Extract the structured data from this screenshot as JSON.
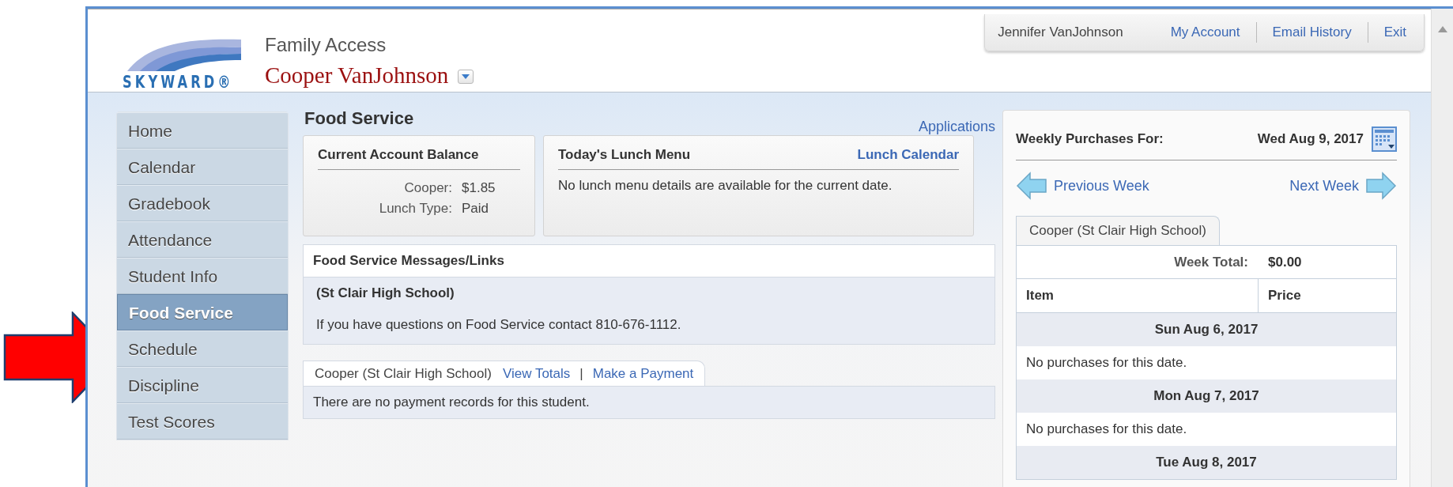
{
  "header": {
    "logo_text": "SKYWARD®",
    "app_title": "Family Access",
    "student_name": "Cooper VanJohnson"
  },
  "user_menu": {
    "user_name": "Jennifer VanJohnson",
    "links": [
      "My Account",
      "Email History",
      "Exit"
    ]
  },
  "sidebar": {
    "items": [
      {
        "label": "Home",
        "selected": false
      },
      {
        "label": "Calendar",
        "selected": false
      },
      {
        "label": "Gradebook",
        "selected": false
      },
      {
        "label": "Attendance",
        "selected": false
      },
      {
        "label": "Student Info",
        "selected": false
      },
      {
        "label": "Food Service",
        "selected": true
      },
      {
        "label": "Schedule",
        "selected": false
      },
      {
        "label": "Discipline",
        "selected": false
      },
      {
        "label": "Test Scores",
        "selected": false
      }
    ]
  },
  "food_service": {
    "title": "Food Service",
    "applications_link": "Applications",
    "balance_card": {
      "title": "Current Account Balance",
      "rows": [
        {
          "label": "Cooper:",
          "value": "$1.85"
        },
        {
          "label": "Lunch Type:",
          "value": "Paid"
        }
      ]
    },
    "lunch_menu_card": {
      "title": "Today's Lunch Menu",
      "link": "Lunch Calendar",
      "message": "No lunch menu details are available for the current date."
    },
    "messages": {
      "title": "Food Service Messages/Links",
      "school": "(St Clair High School)",
      "text": "If you have questions on Food Service contact 810-676-1112."
    },
    "payments": {
      "tab_label": "Cooper (St Clair High School)",
      "links": [
        "View Totals",
        "Make a Payment"
      ],
      "separator": "|",
      "message": "There are no payment records for this student."
    }
  },
  "weekly_purchases": {
    "label": "Weekly Purchases For:",
    "date": "Wed Aug 9, 2017",
    "previous_link": "Previous Week",
    "next_link": "Next Week",
    "tab_label": "Cooper (St Clair High School)",
    "week_total_label": "Week Total:",
    "week_total": "$0.00",
    "columns": [
      "Item",
      "Price"
    ],
    "days": [
      {
        "date": "Sun Aug 6, 2017",
        "message": "No purchases for this date."
      },
      {
        "date": "Mon Aug 7, 2017",
        "message": "No purchases for this date."
      },
      {
        "date": "Tue Aug 8, 2017"
      }
    ]
  }
}
